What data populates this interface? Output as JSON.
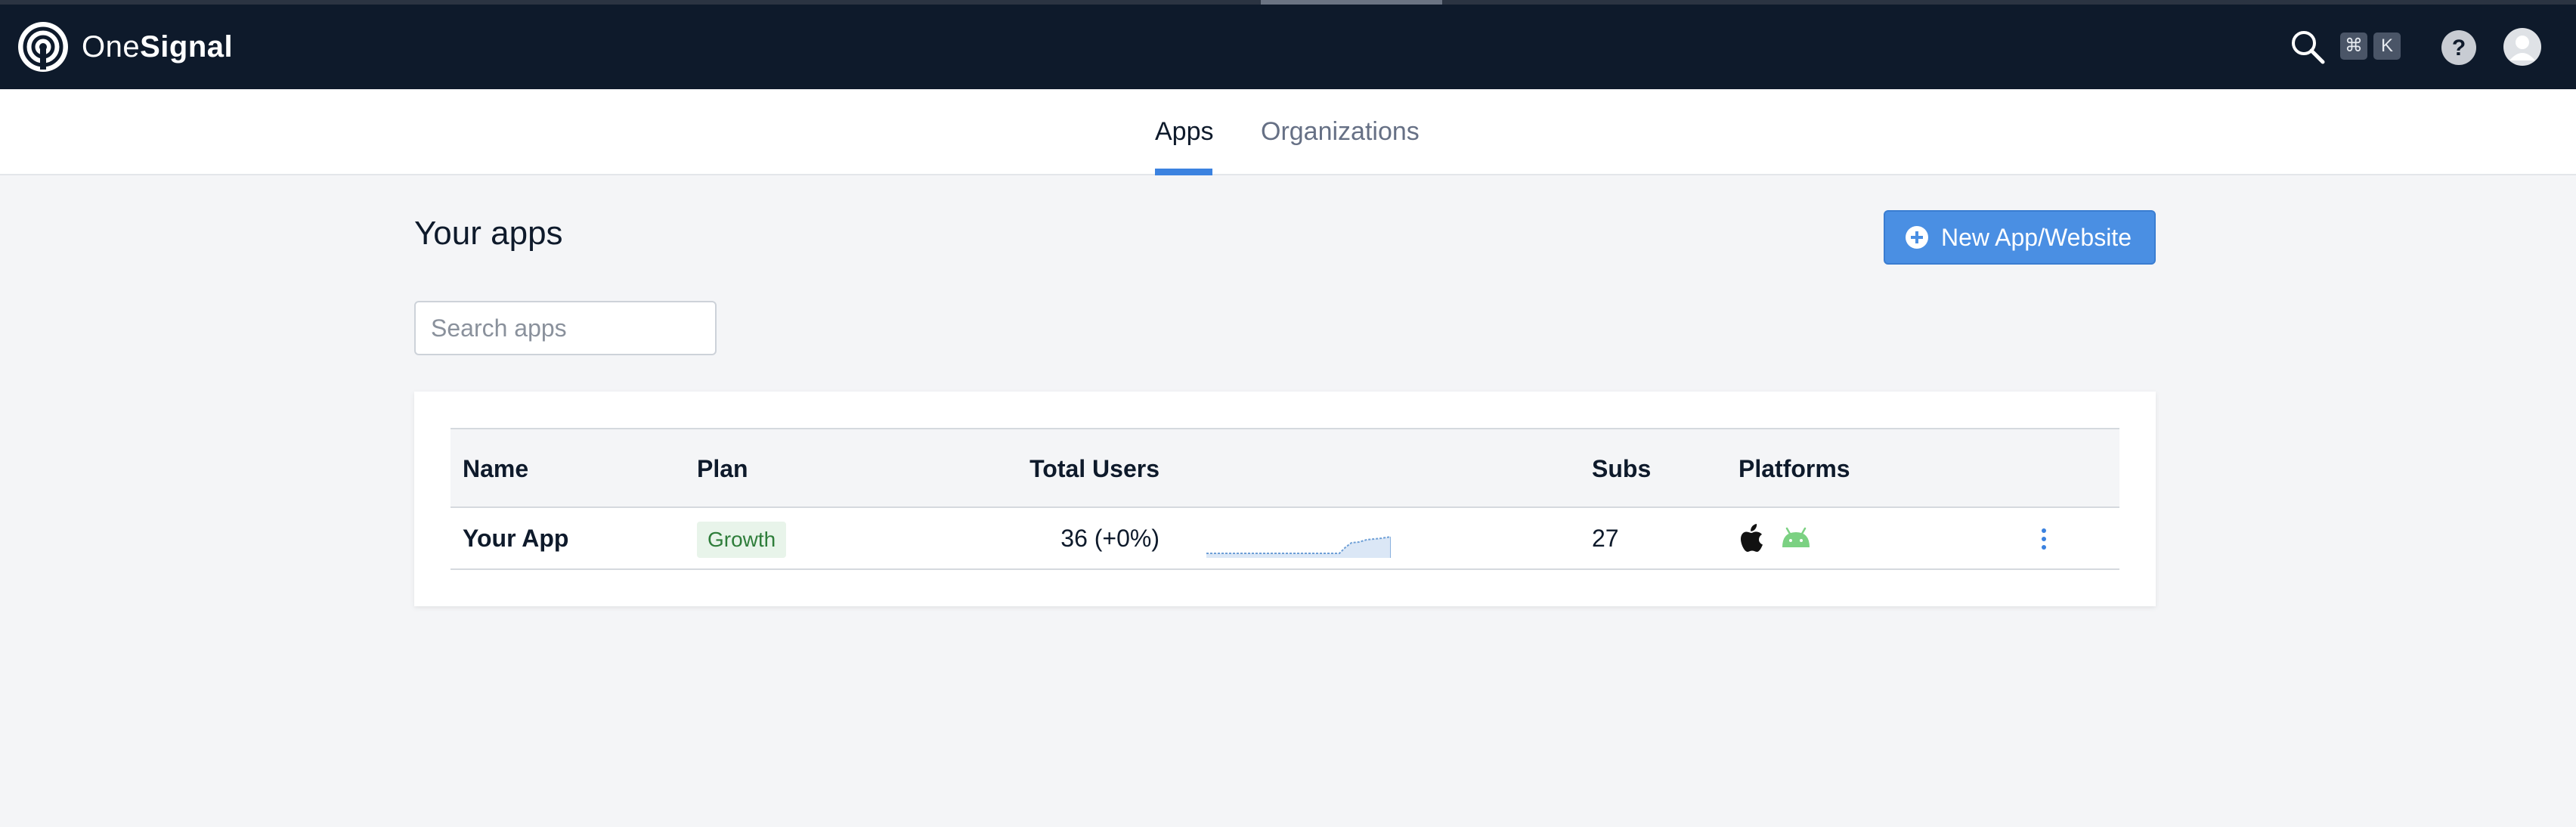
{
  "brand": {
    "name_light": "One",
    "name_bold": "Signal"
  },
  "header": {
    "search_icon": "search-icon",
    "shortcut_keys": [
      "⌘",
      "K"
    ],
    "help_icon": "help-icon",
    "avatar_icon": "user-avatar-icon"
  },
  "tabs": [
    {
      "label": "Apps",
      "active": true
    },
    {
      "label": "Organizations",
      "active": false
    }
  ],
  "main": {
    "title": "Your apps",
    "new_button_label": "New App/Website",
    "search_placeholder": "Search apps"
  },
  "table": {
    "columns": [
      "Name",
      "Plan",
      "Total Users",
      "Subs",
      "Platforms"
    ],
    "rows": [
      {
        "name": "Your App",
        "plan": "Growth",
        "total_users": "36 (+0%)",
        "subs": "27",
        "platforms": [
          "apple-icon",
          "android-icon"
        ]
      }
    ]
  },
  "colors": {
    "topbar": "#0e1a2b",
    "accent": "#4a8fe3",
    "badge_bg": "#e8f4ea",
    "badge_text": "#2e7d3a",
    "android_green": "#7bd182"
  }
}
